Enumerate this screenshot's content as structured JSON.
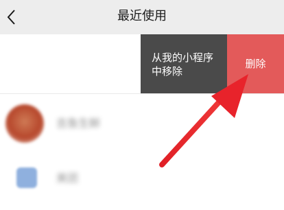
{
  "header": {
    "title": "最近使用"
  },
  "swipe_actions": {
    "remove_label": "从我的小程序\n中移除",
    "delete_label": "删除"
  },
  "list": [
    {
      "name": "吉鱼生鲜",
      "icon": "mini-program-avatar"
    },
    {
      "name": "美团",
      "icon": "mini-program-avatar"
    }
  ],
  "annotation": {
    "arrow_color": "#e8232b",
    "points_to": "delete-button"
  },
  "colors": {
    "nav_bg": "#ededed",
    "remove_bg": "#4a4a4a",
    "delete_bg": "#e35a5a"
  }
}
